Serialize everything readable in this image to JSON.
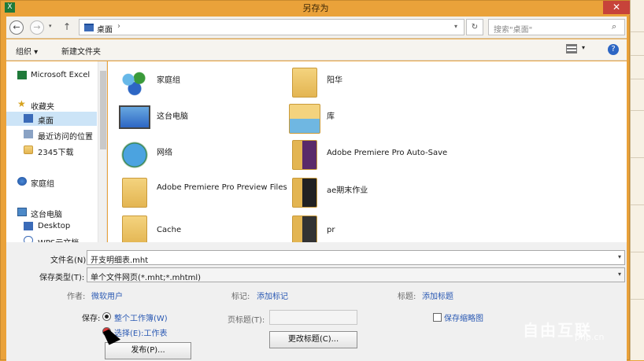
{
  "window": {
    "title": "另存为",
    "close_glyph": "✕"
  },
  "nav": {
    "back_glyph": "←",
    "forward_glyph": "→",
    "up_glyph": "↑",
    "address_path": "桌面",
    "address_sep": "›",
    "refresh_glyph": "↻",
    "search_placeholder": "搜索\"桌面\"",
    "search_icon": "search-icon"
  },
  "toolbar": {
    "organize": "组织 ▾",
    "new_folder": "新建文件夹",
    "help": "?"
  },
  "sidebar": {
    "items": [
      {
        "label": "Microsoft Excel",
        "icon": "excel-icon"
      },
      {
        "label": "收藏夹",
        "icon": "star-icon"
      },
      {
        "label": "桌面",
        "icon": "desktop-icon",
        "selected": true
      },
      {
        "label": "最近访问的位置",
        "icon": "recent-icon"
      },
      {
        "label": "2345下载",
        "icon": "folder-icon"
      },
      {
        "label": "家庭组",
        "icon": "homegroup-icon"
      },
      {
        "label": "这台电脑",
        "icon": "computer-icon"
      },
      {
        "label": "Desktop",
        "icon": "folder-icon"
      },
      {
        "label": "WPS云文档",
        "icon": "cloud-icon"
      }
    ]
  },
  "files": [
    {
      "label": "家庭组",
      "icon": "homegroup-icon"
    },
    {
      "label": "阳华",
      "icon": "user-folder-icon"
    },
    {
      "label": "这台电脑",
      "icon": "computer-icon"
    },
    {
      "label": "库",
      "icon": "library-icon"
    },
    {
      "label": "网络",
      "icon": "network-icon"
    },
    {
      "label": "Adobe Premiere Pro Auto-Save",
      "icon": "folder-icon"
    },
    {
      "label": "Adobe Premiere Pro Preview Files",
      "icon": "folder-icon"
    },
    {
      "label": "ae期末作业",
      "icon": "folder-icon"
    },
    {
      "label": "Cache",
      "icon": "folder-icon"
    },
    {
      "label": "pr",
      "icon": "folder-icon"
    }
  ],
  "form": {
    "filename_label": "文件名(N):",
    "filename_value": "开支明细表.mht",
    "filetype_label": "保存类型(T):",
    "filetype_value": "单个文件网页(*.mht;*.mhtml)",
    "author_label": "作者:",
    "author_value": "微软用户",
    "tags_label": "标记:",
    "tags_value": "添加标记",
    "title_label": "标题:",
    "title_value": "添加标题",
    "save_label": "保存:",
    "radio_workbook": "整个工作簿(W)",
    "radio_selection": "选择(E):工作表",
    "page_title_label": "页标题(T):",
    "thumbnail_label": "保存缩略图",
    "publish_button": "发布(P)...",
    "change_title_button": "更改标题(C)..."
  },
  "watermark": {
    "text": "自由互联",
    "sub": "php.cn"
  },
  "colors": {
    "frame": "#eaa23a",
    "selection": "#cce4f7",
    "link": "#2a59b3",
    "close": "#c7433a"
  }
}
